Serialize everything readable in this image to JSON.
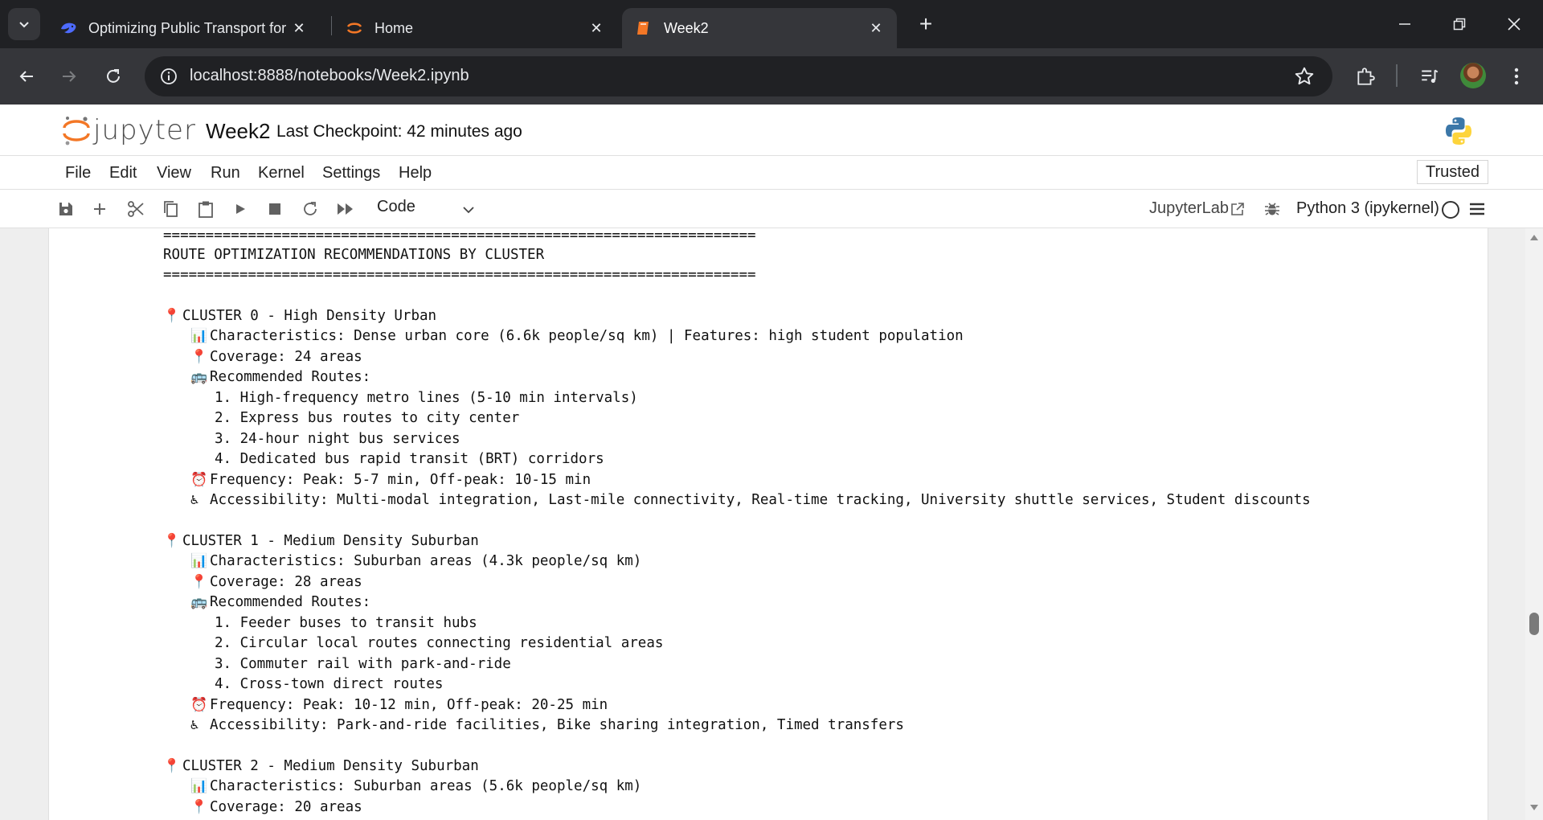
{
  "browser": {
    "tabs": [
      {
        "title": "Optimizing Public Transport for",
        "icon": "deepseek-whale-icon"
      },
      {
        "title": "Home",
        "icon": "jupyter-icon"
      },
      {
        "title": "Week2",
        "icon": "notebook-icon"
      }
    ],
    "url": "localhost:8888/notebooks/Week2.ipynb"
  },
  "jupyter": {
    "logo_text": "jupyter",
    "notebook_name": "Week2",
    "checkpoint": "Last Checkpoint: 42 minutes ago",
    "menu": [
      "File",
      "Edit",
      "View",
      "Run",
      "Kernel",
      "Settings",
      "Help"
    ],
    "trusted": "Trusted",
    "cell_type": "Code",
    "jupyterlab_link": "JupyterLab",
    "kernel": "Python 3 (ipykernel)"
  },
  "output": {
    "sep_top": "======================================================================",
    "heading": "ROUTE OPTIMIZATION RECOMMENDATIONS BY CLUSTER",
    "sep_bottom": "======================================================================",
    "clusters": [
      {
        "title": "CLUSTER 0 - High Density Urban",
        "characteristics": "Characteristics: Dense urban core (6.6k people/sq km) | Features: high student population",
        "coverage": "Coverage: 24 areas",
        "routes_label": "Recommended Routes:",
        "routes": [
          "1. High-frequency metro lines (5-10 min intervals)",
          "2. Express bus routes to city center",
          "3. 24-hour night bus services",
          "4. Dedicated bus rapid transit (BRT) corridors"
        ],
        "frequency": "Frequency: Peak: 5-7 min, Off-peak: 10-15 min",
        "accessibility": "Accessibility: Multi-modal integration, Last-mile connectivity, Real-time tracking, University shuttle services, Student discounts"
      },
      {
        "title": "CLUSTER 1 - Medium Density Suburban",
        "characteristics": "Characteristics: Suburban areas (4.3k people/sq km)",
        "coverage": "Coverage: 28 areas",
        "routes_label": "Recommended Routes:",
        "routes": [
          "1. Feeder buses to transit hubs",
          "2. Circular local routes connecting residential areas",
          "3. Commuter rail with park-and-ride",
          "4. Cross-town direct routes"
        ],
        "frequency": "Frequency: Peak: 10-12 min, Off-peak: 20-25 min",
        "accessibility": "Accessibility: Park-and-ride facilities, Bike sharing integration, Timed transfers"
      },
      {
        "title": "CLUSTER 2 - Medium Density Suburban",
        "characteristics": "Characteristics: Suburban areas (5.6k people/sq km)",
        "coverage": "Coverage: 20 areas"
      }
    ]
  }
}
